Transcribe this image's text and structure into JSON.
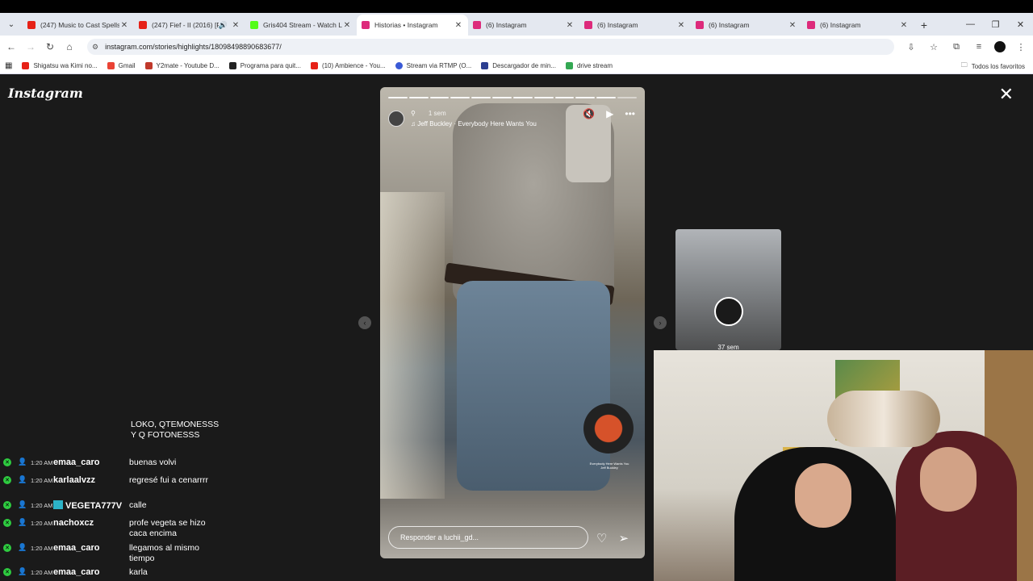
{
  "browser": {
    "tabs": [
      {
        "title": "(247) Music to Cast Spells",
        "icon_color": "#e62117"
      },
      {
        "title": "(247) Fief - II (2016) [F",
        "icon_color": "#e62117",
        "sound": "speaker-icon"
      },
      {
        "title": "Gris404 Stream - Watch L",
        "icon_color": "#53fc18"
      },
      {
        "title": "Historias • Instagram",
        "icon_color": "#dd2a7b",
        "active": true
      },
      {
        "title": "(6) Instagram",
        "icon_color": "#dd2a7b"
      },
      {
        "title": "(6) Instagram",
        "icon_color": "#dd2a7b"
      },
      {
        "title": "(6) Instagram",
        "icon_color": "#dd2a7b"
      },
      {
        "title": "(6) Instagram",
        "icon_color": "#dd2a7b"
      }
    ],
    "url": "instagram.com/stories/highlights/18098498890683677/",
    "bookmarks": [
      {
        "label": "Shigatsu wa Kimi no...",
        "color": "#e62117"
      },
      {
        "label": "Gmail",
        "color": "#ea4335"
      },
      {
        "label": "Y2mate - Youtube D...",
        "color": "#c0392b"
      },
      {
        "label": "Programa para quit...",
        "color": "#222222"
      },
      {
        "label": "(10) Ambience - You...",
        "color": "#e62117"
      },
      {
        "label": "Stream via RTMP (O...",
        "color": "#3a5ad6"
      },
      {
        "label": "Descargador de min...",
        "color": "#2c3e90"
      },
      {
        "label": "drive stream",
        "color": "#34a853"
      }
    ],
    "all_bookmarks": "Todos los favoritos"
  },
  "instagram": {
    "logo": "Instagram",
    "story": {
      "time": "1 sem",
      "song": "Jeff Buckley · Everybody Here Wants You",
      "reply_placeholder": "Responder a luchii_gd...",
      "music_caption_1": "Everybody Here Wants You",
      "music_caption_2": "Jeff Buckley",
      "segments_total": 12,
      "segments_done": 11
    },
    "next_story_time": "37 sem"
  },
  "chat": {
    "first_message": "LOKO, QTEMONESSS Y Q FOTONESSS",
    "rows": [
      {
        "time": "1:20 AM",
        "user": "emaa_caro",
        "msg": "buenas volvi"
      },
      {
        "time": "1:20 AM",
        "user": "karlaalvzz",
        "msg": "regresé fui a cenarrrr"
      },
      {
        "time": "1:20 AM",
        "user": "VEGETA777V",
        "msg": "calle",
        "badge": true
      },
      {
        "time": "1:20 AM",
        "user": "nachoxcz",
        "msg": "profe vegeta se hizo caca encima"
      },
      {
        "time": "1:20 AM",
        "user": "emaa_caro",
        "msg": "llegamos al mismo tiempo"
      },
      {
        "time": "1:20 AM",
        "user": "emaa_caro",
        "msg": "karla"
      }
    ]
  }
}
